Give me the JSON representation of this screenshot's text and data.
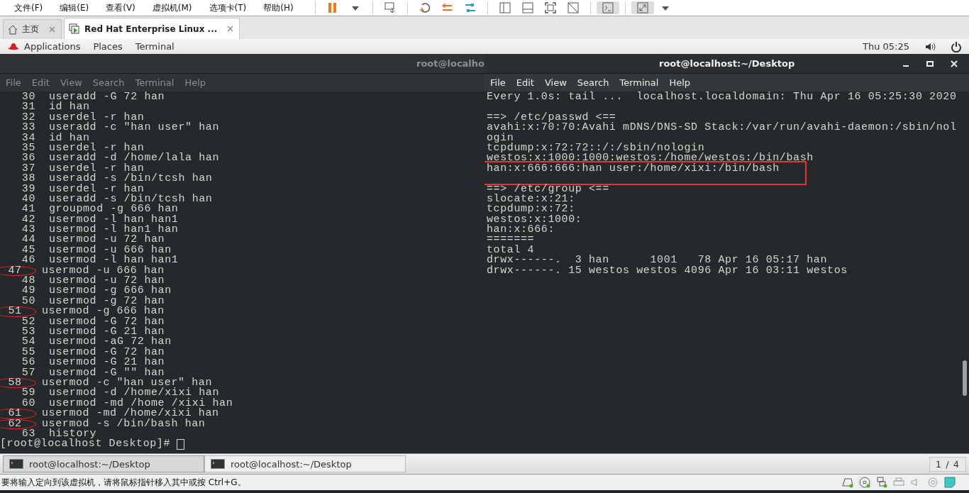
{
  "vm_menu": [
    "文件(F)",
    "编辑(E)",
    "查看(V)",
    "虚拟机(M)",
    "选项卡(T)",
    "帮助(H)"
  ],
  "vm_tabs": [
    {
      "label": "主页",
      "selected": false,
      "kind": "home"
    },
    {
      "label": "Red Hat Enterprise Linux ...",
      "selected": true,
      "kind": "vm"
    }
  ],
  "gnome_bar": {
    "menus": [
      "Applications",
      "Places",
      "Terminal"
    ],
    "clock": "Thu 05:25"
  },
  "terminals": [
    {
      "title": "root@localho",
      "active": false,
      "menu": [
        "File",
        "Edit",
        "View",
        "Search",
        "Terminal",
        "Help"
      ],
      "prompt": "[root@localhost Desktop]#",
      "lines": [
        {
          "kind": "history",
          "num": "30",
          "cmd": "useradd -G 72 han",
          "circled": false
        },
        {
          "kind": "history",
          "num": "31",
          "cmd": "id han",
          "circled": false
        },
        {
          "kind": "history",
          "num": "32",
          "cmd": "userdel -r han",
          "circled": false
        },
        {
          "kind": "history",
          "num": "33",
          "cmd": "useradd -c \"han user\" han",
          "circled": false
        },
        {
          "kind": "history",
          "num": "34",
          "cmd": "id han",
          "circled": false
        },
        {
          "kind": "history",
          "num": "35",
          "cmd": "userdel -r han",
          "circled": false
        },
        {
          "kind": "history",
          "num": "36",
          "cmd": "useradd -d /home/lala han",
          "circled": false
        },
        {
          "kind": "history",
          "num": "37",
          "cmd": "userdel -r han",
          "circled": false
        },
        {
          "kind": "history",
          "num": "38",
          "cmd": "useradd -s /bin/tcsh han",
          "circled": false
        },
        {
          "kind": "history",
          "num": "39",
          "cmd": "userdel -r han",
          "circled": false
        },
        {
          "kind": "history",
          "num": "40",
          "cmd": "useradd -s /bin/tcsh han",
          "circled": false
        },
        {
          "kind": "history",
          "num": "41",
          "cmd": "groupmod -g 666 han",
          "circled": false
        },
        {
          "kind": "history",
          "num": "42",
          "cmd": "usermod -l han han1",
          "circled": false
        },
        {
          "kind": "history",
          "num": "43",
          "cmd": "usermod -l han1 han",
          "circled": false
        },
        {
          "kind": "history",
          "num": "44",
          "cmd": "usermod -u 72 han",
          "circled": false
        },
        {
          "kind": "history",
          "num": "45",
          "cmd": "usermod -u 666 han",
          "circled": false
        },
        {
          "kind": "history",
          "num": "46",
          "cmd": "usermod -l han han1",
          "circled": false
        },
        {
          "kind": "history",
          "num": "47",
          "cmd": "usermod -u 666 han",
          "circled": true
        },
        {
          "kind": "history",
          "num": "48",
          "cmd": "usermod -u 72 han",
          "circled": false
        },
        {
          "kind": "history",
          "num": "49",
          "cmd": "usermod -g 666 han",
          "circled": false
        },
        {
          "kind": "history",
          "num": "50",
          "cmd": "usermod -g 72 han",
          "circled": false
        },
        {
          "kind": "history",
          "num": "51",
          "cmd": "usermod -g 666 han",
          "circled": true
        },
        {
          "kind": "history",
          "num": "52",
          "cmd": "usermod -G 72 han",
          "circled": false
        },
        {
          "kind": "history",
          "num": "53",
          "cmd": "usermod -G 21 han",
          "circled": false
        },
        {
          "kind": "history",
          "num": "54",
          "cmd": "usermod -aG 72 han",
          "circled": false
        },
        {
          "kind": "history",
          "num": "55",
          "cmd": "usermod -G 72 han",
          "circled": false
        },
        {
          "kind": "history",
          "num": "56",
          "cmd": "usermod -G 21 han",
          "circled": false
        },
        {
          "kind": "history",
          "num": "57",
          "cmd": "usermod -G \"\" han",
          "circled": false
        },
        {
          "kind": "history",
          "num": "58",
          "cmd": "usermod -c \"han user\" han",
          "circled": true
        },
        {
          "kind": "history",
          "num": "59",
          "cmd": "usermod -d /home/xixi han",
          "circled": false
        },
        {
          "kind": "history",
          "num": "60",
          "cmd": "usermod -md /home /xixi han",
          "circled": false
        },
        {
          "kind": "history",
          "num": "61",
          "cmd": "usermod -md /home/xixi han",
          "circled": true
        },
        {
          "kind": "history",
          "num": "62",
          "cmd": "usermod -s /bin/bash han",
          "circled": true
        },
        {
          "kind": "history",
          "num": "63",
          "cmd": "history",
          "circled": false
        }
      ]
    },
    {
      "title": "root@localhost:~/Desktop",
      "active": true,
      "menu": [
        "File",
        "Edit",
        "View",
        "Search",
        "Terminal",
        "Help"
      ],
      "lines": [
        {
          "kind": "output",
          "text": "Every 1.0s: tail ...  localhost.localdomain: Thu Apr 16 05:25:30 2020",
          "highlighted": false
        },
        {
          "kind": "blank"
        },
        {
          "kind": "output",
          "text": "==> /etc/passwd <==",
          "highlighted": false
        },
        {
          "kind": "output",
          "text": "avahi:x:70:70:Avahi mDNS/DNS-SD Stack:/var/run/avahi-daemon:/sbin/nol",
          "highlighted": false
        },
        {
          "kind": "output",
          "text": "ogin",
          "highlighted": false
        },
        {
          "kind": "output",
          "text": "tcpdump:x:72:72::/:/sbin/nologin",
          "highlighted": false
        },
        {
          "kind": "output",
          "text": "westos:x:1000:1000:westos:/home/westos:/bin/bash",
          "highlighted": false
        },
        {
          "kind": "output",
          "text": "han:x:666:666:han user:/home/xixi:/bin/bash",
          "highlighted": true
        },
        {
          "kind": "blank"
        },
        {
          "kind": "output",
          "text": "==> /etc/group <==",
          "highlighted": false
        },
        {
          "kind": "output",
          "text": "slocate:x:21:",
          "highlighted": false
        },
        {
          "kind": "output",
          "text": "tcpdump:x:72:",
          "highlighted": false
        },
        {
          "kind": "output",
          "text": "westos:x:1000:",
          "highlighted": false
        },
        {
          "kind": "output",
          "text": "han:x:666:",
          "highlighted": false
        },
        {
          "kind": "output",
          "text": "=======",
          "highlighted": false
        },
        {
          "kind": "output",
          "text": "total 4",
          "highlighted": false
        },
        {
          "kind": "output",
          "text": "drwx------.  3 han      1001   78 Apr 16 05:17 han",
          "highlighted": false
        },
        {
          "kind": "output",
          "text": "drwx------. 15 westos westos 4096 Apr 16 03:11 westos",
          "highlighted": false
        }
      ]
    }
  ],
  "taskbar": {
    "windows": [
      {
        "label": "root@localhost:~/Desktop",
        "selected": true
      },
      {
        "label": "root@localhost:~/Desktop",
        "selected": false
      }
    ],
    "workspace": "1 / 4"
  },
  "status_bar": {
    "message": "要将输入定向到该虚拟机，请将鼠标指针移入其中或按 Ctrl+G。"
  }
}
